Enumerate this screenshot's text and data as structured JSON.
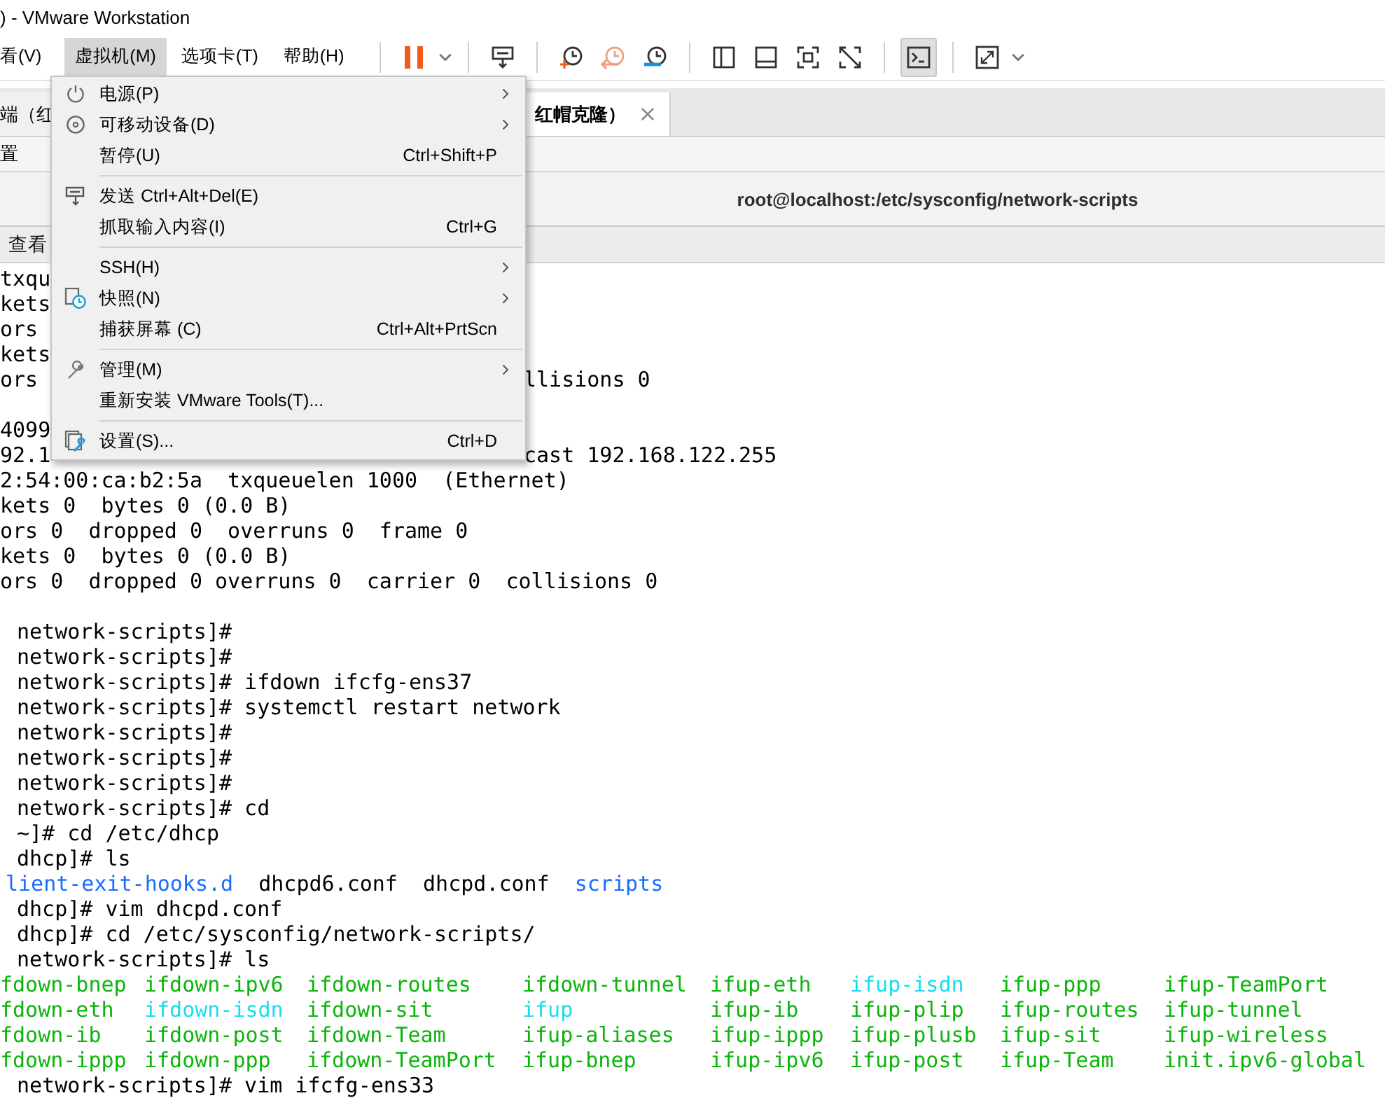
{
  "window": {
    "title": ") - VMware Workstation"
  },
  "menubar": [
    {
      "label": "看(V)",
      "selected": false
    },
    {
      "label": "虚拟机(M)",
      "selected": true
    },
    {
      "label": "选项卡(T)",
      "selected": false
    },
    {
      "label": "帮助(H)",
      "selected": false
    }
  ],
  "toolbar": {
    "console_selected": true
  },
  "tabs": [
    {
      "label": "端（红",
      "selected": false
    },
    {
      "label": "红帽克隆）",
      "selected": true
    }
  ],
  "subtoolbar": {
    "label": "置"
  },
  "terminal": {
    "title": "root@localhost:/etc/sysconfig/network-scripts",
    "menu": [
      "查看"
    ],
    "lines": [
      {
        "kind": "text",
        "text": "txqu"
      },
      {
        "kind": "text",
        "text": "kets"
      },
      {
        "kind": "text",
        "text": "ors"
      },
      {
        "kind": "text",
        "text": "kets"
      },
      {
        "kind": "text",
        "text": "ors",
        "right": "llisions 0"
      },
      {
        "kind": "blank"
      },
      {
        "kind": "text",
        "text": "4099"
      },
      {
        "kind": "text",
        "text": "92.1",
        "right": "cast 192.168.122.255"
      },
      {
        "kind": "text",
        "text": "2:54:00:ca:b2:5a  txqueuelen 1000  (Ethernet)"
      },
      {
        "kind": "text",
        "text": "kets 0  bytes 0 (0.0 B)"
      },
      {
        "kind": "text",
        "text": "ors 0  dropped 0  overruns 0  frame 0"
      },
      {
        "kind": "text",
        "text": "kets 0  bytes 0 (0.0 B)"
      },
      {
        "kind": "text",
        "text": "ors 0  dropped 0 overruns 0  carrier 0  collisions 0"
      },
      {
        "kind": "blank"
      },
      {
        "kind": "prompt",
        "prompt": "network-scripts]#"
      },
      {
        "kind": "prompt",
        "prompt": "network-scripts]#"
      },
      {
        "kind": "prompt",
        "prompt": "network-scripts]#",
        "command": "ifdown ifcfg-ens37"
      },
      {
        "kind": "prompt",
        "prompt": "network-scripts]#",
        "command": "systemctl restart network"
      },
      {
        "kind": "prompt",
        "prompt": "network-scripts]#"
      },
      {
        "kind": "prompt",
        "prompt": "network-scripts]#"
      },
      {
        "kind": "prompt",
        "prompt": "network-scripts]#"
      },
      {
        "kind": "prompt",
        "prompt": "network-scripts]#",
        "command": "cd"
      },
      {
        "kind": "prompt",
        "prompt": "~]#",
        "command": "cd /etc/dhcp"
      },
      {
        "kind": "prompt",
        "prompt": "dhcp]#",
        "command": "ls"
      },
      {
        "kind": "listing",
        "items": [
          {
            "text": "lient-exit-hooks.d",
            "color": "#1a6cff"
          },
          {
            "text": "dhcpd6.conf",
            "color": "#000000"
          },
          {
            "text": "dhcpd.conf",
            "color": "#000000"
          },
          {
            "text": "scripts",
            "color": "#1a6cff"
          }
        ]
      },
      {
        "kind": "prompt",
        "prompt": "dhcp]#",
        "command": "vim dhcpd.conf"
      },
      {
        "kind": "prompt",
        "prompt": "dhcp]#",
        "command": "cd /etc/sysconfig/network-scripts/"
      },
      {
        "kind": "prompt",
        "prompt": "network-scripts]#",
        "command": "ls"
      },
      {
        "kind": "grid",
        "items": [
          {
            "text": "fdown-bnep",
            "color": "#0cb40c"
          },
          {
            "text": "ifdown-ipv6",
            "color": "#0cb40c"
          },
          {
            "text": "ifdown-routes",
            "color": "#0cb40c"
          },
          {
            "text": "ifdown-tunnel",
            "color": "#0cb40c"
          },
          {
            "text": "ifup-eth",
            "color": "#0cb40c"
          },
          {
            "text": "ifup-isdn",
            "color": "#1adcf0"
          },
          {
            "text": "ifup-ppp",
            "color": "#0cb40c"
          },
          {
            "text": "ifup-TeamPort",
            "color": "#0cb40c"
          }
        ]
      },
      {
        "kind": "grid",
        "items": [
          {
            "text": "fdown-eth",
            "color": "#0cb40c"
          },
          {
            "text": "ifdown-isdn",
            "color": "#1adcf0"
          },
          {
            "text": "ifdown-sit",
            "color": "#0cb40c"
          },
          {
            "text": "ifup",
            "color": "#1adcf0"
          },
          {
            "text": "ifup-ib",
            "color": "#0cb40c"
          },
          {
            "text": "ifup-plip",
            "color": "#0cb40c"
          },
          {
            "text": "ifup-routes",
            "color": "#0cb40c"
          },
          {
            "text": "ifup-tunnel",
            "color": "#0cb40c"
          }
        ]
      },
      {
        "kind": "grid",
        "items": [
          {
            "text": "fdown-ib",
            "color": "#0cb40c"
          },
          {
            "text": "ifdown-post",
            "color": "#0cb40c"
          },
          {
            "text": "ifdown-Team",
            "color": "#0cb40c"
          },
          {
            "text": "ifup-aliases",
            "color": "#0cb40c"
          },
          {
            "text": "ifup-ippp",
            "color": "#0cb40c"
          },
          {
            "text": "ifup-plusb",
            "color": "#0cb40c"
          },
          {
            "text": "ifup-sit",
            "color": "#0cb40c"
          },
          {
            "text": "ifup-wireless",
            "color": "#0cb40c"
          }
        ]
      },
      {
        "kind": "grid",
        "items": [
          {
            "text": "fdown-ippp",
            "color": "#0cb40c"
          },
          {
            "text": "ifdown-ppp",
            "color": "#0cb40c"
          },
          {
            "text": "ifdown-TeamPort",
            "color": "#0cb40c"
          },
          {
            "text": "ifup-bnep",
            "color": "#0cb40c"
          },
          {
            "text": "ifup-ipv6",
            "color": "#0cb40c"
          },
          {
            "text": "ifup-post",
            "color": "#0cb40c"
          },
          {
            "text": "ifup-Team",
            "color": "#0cb40c"
          },
          {
            "text": "init.ipv6-global",
            "color": "#0cb40c"
          }
        ]
      },
      {
        "kind": "prompt",
        "prompt": "network-scripts]#",
        "command": "vim ifcfg-ens33"
      }
    ]
  },
  "dropdown": {
    "groups": [
      [
        {
          "label": "电源(P)",
          "submenu": true
        },
        {
          "label": "可移动设备(D)",
          "submenu": true
        },
        {
          "label": "暂停(U)",
          "shortcut": "Ctrl+Shift+P",
          "submenu": false
        }
      ],
      [
        {
          "label": "发送 Ctrl+Alt+Del(E)",
          "submenu": false
        },
        {
          "label": "抓取输入内容(I)",
          "shortcut": "Ctrl+G",
          "submenu": false
        }
      ],
      [
        {
          "label": "SSH(H)",
          "submenu": true
        },
        {
          "label": "快照(N)",
          "submenu": true
        },
        {
          "label": "捕获屏幕 (C)",
          "shortcut": "Ctrl+Alt+PrtScn",
          "submenu": false
        }
      ],
      [
        {
          "label": "管理(M)",
          "submenu": true
        },
        {
          "label": "重新安装 VMware Tools(T)...",
          "submenu": false
        }
      ],
      [
        {
          "label": "设置(S)...",
          "shortcut": "Ctrl+D",
          "submenu": false
        }
      ]
    ]
  }
}
